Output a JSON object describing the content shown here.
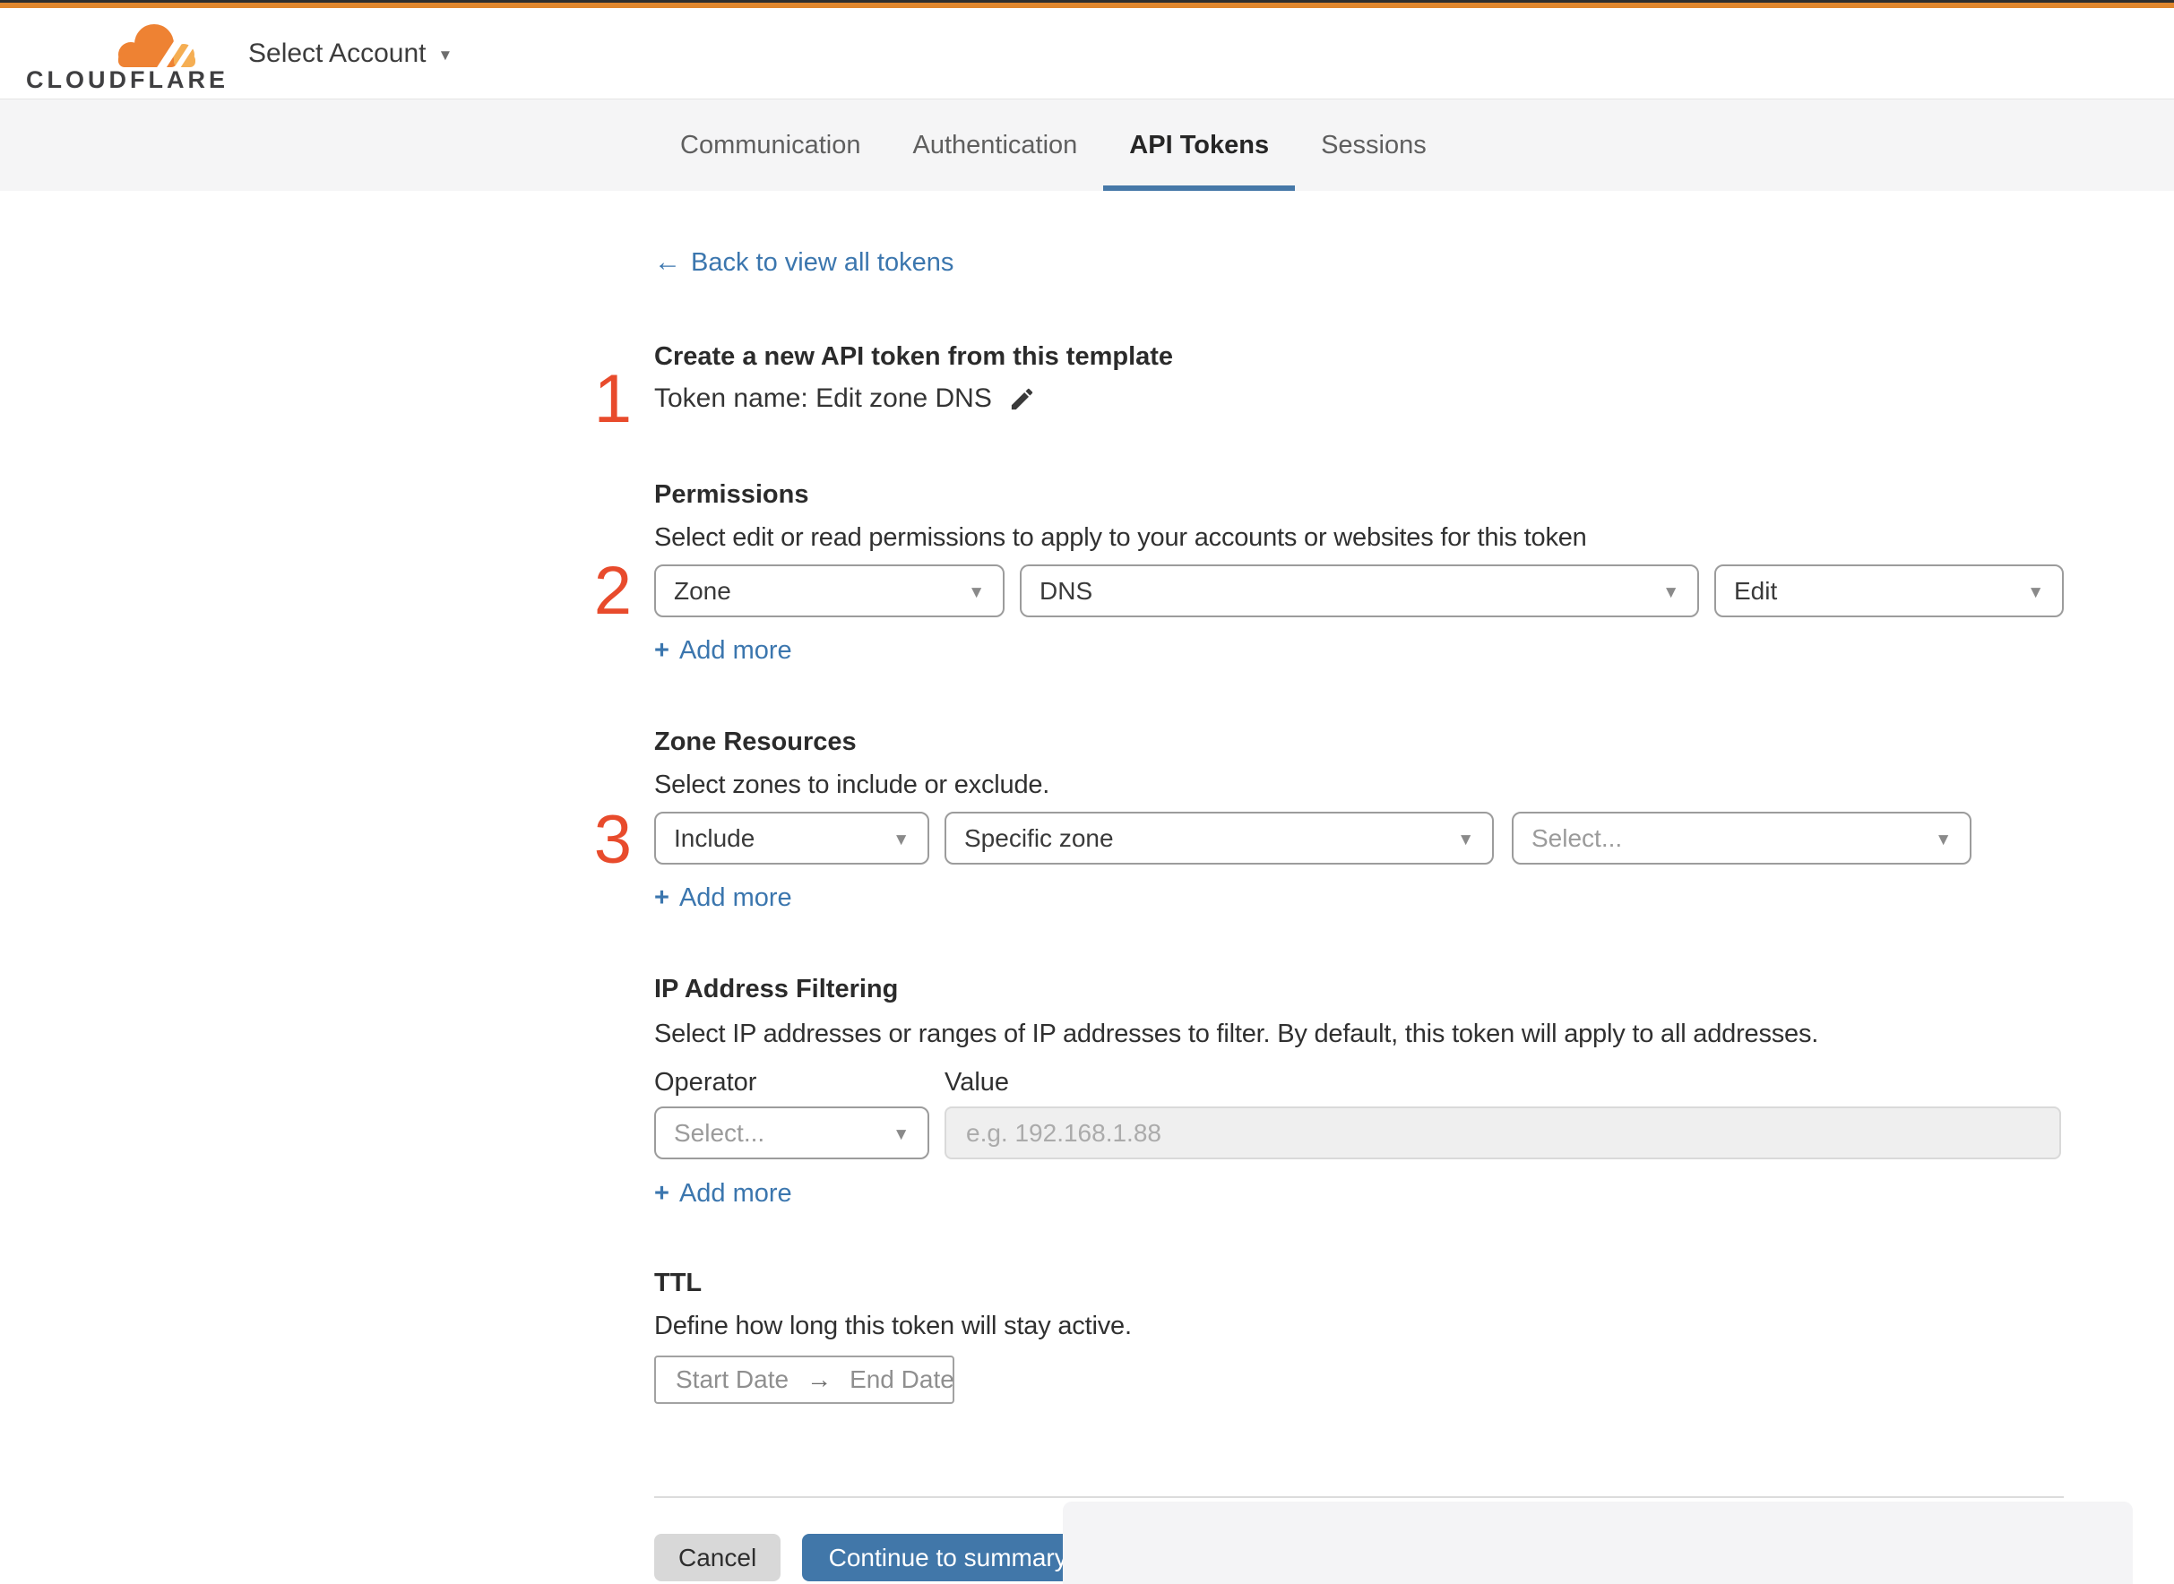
{
  "header": {
    "brand": "CLOUDFLARE",
    "account_selector": "Select Account"
  },
  "tabs": [
    {
      "label": "Communication",
      "active": false
    },
    {
      "label": "Authentication",
      "active": false
    },
    {
      "label": "API Tokens",
      "active": true
    },
    {
      "label": "Sessions",
      "active": false
    }
  ],
  "page": {
    "back_link": "Back to view all tokens",
    "step1": {
      "number": "1",
      "title": "Create a new API token from this template",
      "token_name": "Token name: Edit zone DNS"
    },
    "step2": {
      "number": "2",
      "heading": "Permissions",
      "description": "Select edit or read permissions to apply to your accounts or websites for this token",
      "selects": [
        {
          "value": "Zone"
        },
        {
          "value": "DNS"
        },
        {
          "value": "Edit"
        }
      ],
      "add_more": "Add more"
    },
    "step3": {
      "number": "3",
      "heading": "Zone Resources",
      "description": "Select zones to include or exclude.",
      "selects": [
        {
          "value": "Include"
        },
        {
          "value": "Specific zone"
        },
        {
          "value": "Select..."
        }
      ],
      "add_more": "Add more"
    },
    "ip_filtering": {
      "heading": "IP Address Filtering",
      "description": "Select IP addresses or ranges of IP addresses to filter. By default, this token will apply to all addresses.",
      "operator_label": "Operator",
      "value_label": "Value",
      "operator_value": "Select...",
      "value_placeholder": "e.g. 192.168.1.88",
      "add_more": "Add more"
    },
    "ttl": {
      "heading": "TTL",
      "description": "Define how long this token will stay active.",
      "start_date": "Start Date",
      "end_date": "End Date"
    },
    "footer": {
      "cancel": "Cancel",
      "continue": "Continue to summary"
    }
  },
  "icons": {
    "chevron_down": "▼",
    "back_arrow": "←",
    "arrow_right": "→",
    "plus": "+"
  },
  "colors": {
    "top_bar_orange": "#e0872e",
    "brand_orange": "#ee8233",
    "brand_amber": "#f5ae53",
    "link_blue": "#3b76ae",
    "active_tab_blue": "#4678a8",
    "primary_button_blue": "#4177a9",
    "step_number_red": "#e84b2c"
  }
}
